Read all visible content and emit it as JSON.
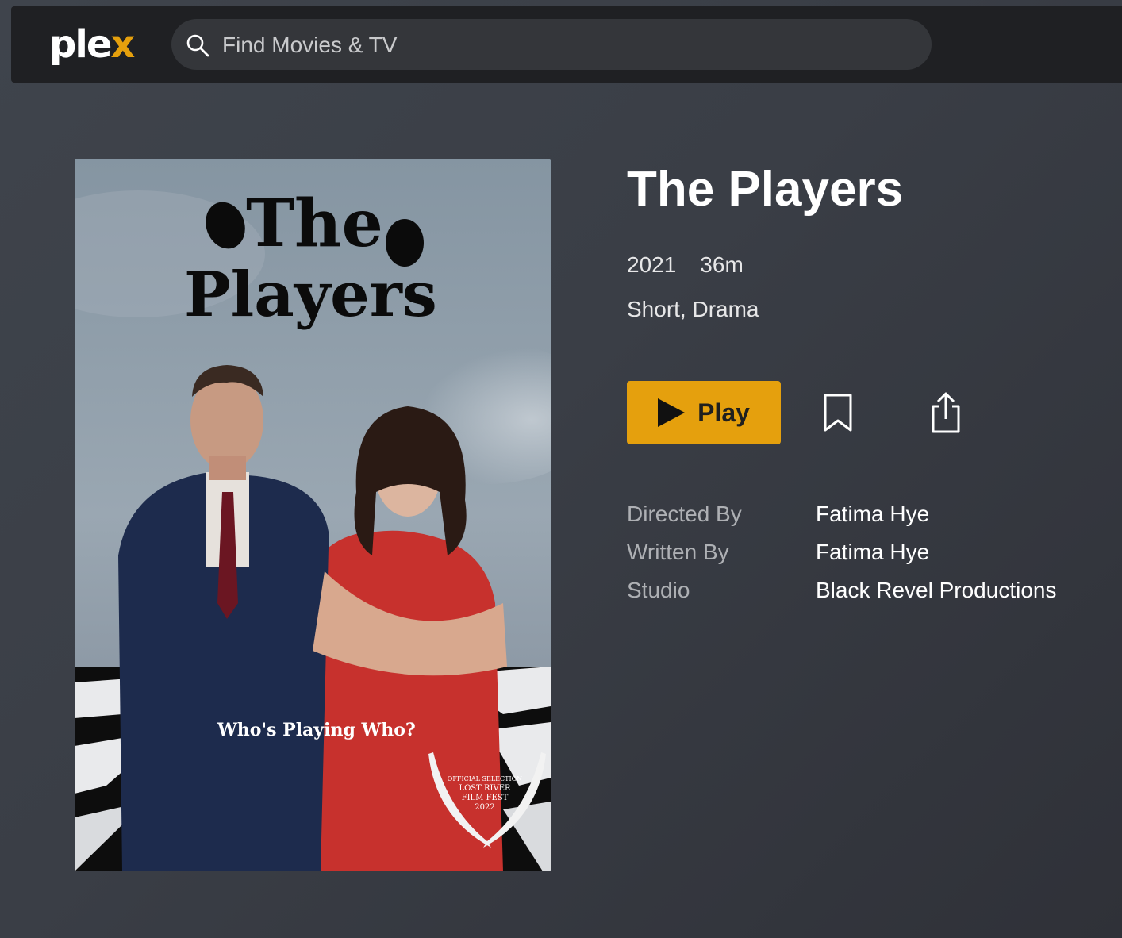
{
  "header": {
    "logo": {
      "text_main": "ple",
      "text_accent": "x"
    },
    "search": {
      "placeholder": "Find Movies & TV",
      "value": ""
    }
  },
  "poster": {
    "title_line1": "The",
    "title_line2": "Players",
    "tagline": "Who's Playing Who?",
    "laurel_lines": [
      "OFFICIAL SELECTION",
      "LOST RIVER",
      "FILM FEST",
      "2022"
    ]
  },
  "movie": {
    "title": "The Players",
    "year": "2021",
    "duration": "36m",
    "genres": "Short, Drama"
  },
  "actions": {
    "play_label": "Play",
    "bookmark_icon": "bookmark-icon",
    "share_icon": "share-icon"
  },
  "credits": [
    {
      "label": "Directed By",
      "value": "Fatima Hye"
    },
    {
      "label": "Written By",
      "value": "Fatima Hye"
    },
    {
      "label": "Studio",
      "value": "Black Revel Productions"
    }
  ],
  "colors": {
    "accent": "#e5a00d",
    "topbar": "#1f2023",
    "search_bg": "#34363a"
  }
}
